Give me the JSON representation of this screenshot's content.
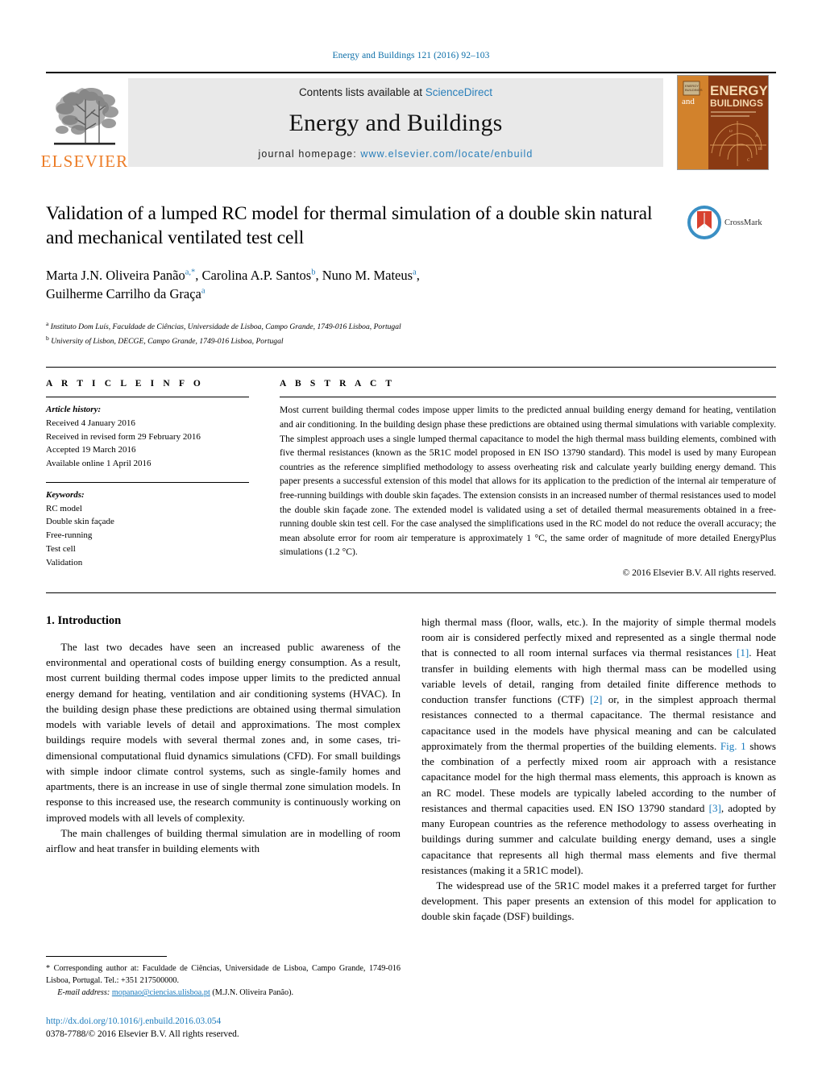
{
  "running_head": "Energy and Buildings 121 (2016) 92–103",
  "masthead": {
    "publisher_name": "ELSEVIER",
    "contents_prefix": "Contents lists available at ",
    "contents_link": "ScienceDirect",
    "journal_name": "Energy and Buildings",
    "homepage_prefix": "journal homepage: ",
    "homepage_url": "www.elsevier.com/locate/enbuild",
    "cover_title_line1": "ENERGY",
    "cover_title_line2": "and",
    "cover_title_line3": "BUILDINGS"
  },
  "article": {
    "title": "Validation of a lumped RC model for thermal simulation of a double skin natural and mechanical ventilated test cell",
    "crossmark_label": "CrossMark",
    "authors": [
      {
        "name": "Marta J.N. Oliveira Panão",
        "marks": "a,*"
      },
      {
        "name": "Carolina A.P. Santos",
        "marks": "b"
      },
      {
        "name": "Nuno M. Mateus",
        "marks": "a"
      },
      {
        "name": "Guilherme Carrilho da Graça",
        "marks": "a"
      }
    ],
    "affiliations": [
      {
        "mark": "a",
        "text": "Instituto Dom Luís, Faculdade de Ciências, Universidade de Lisboa, Campo Grande, 1749-016 Lisboa, Portugal"
      },
      {
        "mark": "b",
        "text": "University of Lisbon, DECGE, Campo Grande, 1749-016 Lisboa, Portugal"
      }
    ]
  },
  "article_info": {
    "heading": "A R T I C L E  I N F O",
    "history_label": "Article history:",
    "history": [
      "Received 4 January 2016",
      "Received in revised form 29 February 2016",
      "Accepted 19 March 2016",
      "Available online 1 April 2016"
    ],
    "keywords_label": "Keywords:",
    "keywords": [
      "RC model",
      "Double skin façade",
      "Free-running",
      "Test cell",
      "Validation"
    ]
  },
  "abstract": {
    "heading": "A B S T R A C T",
    "text": "Most current building thermal codes impose upper limits to the predicted annual building energy demand for heating, ventilation and air conditioning. In the building design phase these predictions are obtained using thermal simulations with variable complexity. The simplest approach uses a single lumped thermal capacitance to model the high thermal mass building elements, combined with five thermal resistances (known as the 5R1C model proposed in EN ISO 13790 standard). This model is used by many European countries as the reference simplified methodology to assess overheating risk and calculate yearly building energy demand. This paper presents a successful extension of this model that allows for its application to the prediction of the internal air temperature of free-running buildings with double skin façades. The extension consists in an increased number of thermal resistances used to model the double skin façade zone. The extended model is validated using a set of detailed thermal measurements obtained in a free-running double skin test cell. For the case analysed the simplifications used in the RC model do not reduce the overall accuracy; the mean absolute error for room air temperature is approximately 1 °C, the same order of magnitude of more detailed EnergyPlus simulations (1.2 °C).",
    "copyright": "© 2016 Elsevier B.V. All rights reserved."
  },
  "introduction": {
    "heading": "1.  Introduction",
    "left_paragraphs": [
      "The last two decades have seen an increased public awareness of the environmental and operational costs of building energy consumption. As a result, most current building thermal codes impose upper limits to the predicted annual energy demand for heating, ventilation and air conditioning systems (HVAC). In the building design phase these predictions are obtained using thermal simulation models with variable levels of detail and approximations. The most complex buildings require models with several thermal zones and, in some cases, tri-dimensional computational fluid dynamics simulations (CFD). For small buildings with simple indoor climate control systems, such as single-family homes and apartments, there is an increase in use of single thermal zone simulation models. In response to this increased use, the research community is continuously working on improved models with all levels of complexity.",
      "The main challenges of building thermal simulation are in modelling of room airflow and heat transfer in building elements with"
    ],
    "right_paragraph_1_part1": "high thermal mass (floor, walls, etc.). In the majority of simple thermal models room air is considered perfectly mixed and represented as a single thermal node that is connected to all room internal surfaces via thermal resistances ",
    "right_ref_1": "[1]",
    "right_paragraph_1_part2": ". Heat transfer in building elements with high thermal mass can be modelled using variable levels of detail, ranging from detailed finite difference methods to conduction transfer functions (CTF) ",
    "right_ref_2": "[2]",
    "right_paragraph_1_part3": " or, in the simplest approach thermal resistances connected to a thermal capacitance. The thermal resistance and capacitance used in the models have physical meaning and can be calculated approximately from the thermal properties of the building elements. ",
    "right_fig_ref": "Fig. 1",
    "right_paragraph_1_part4": " shows the combination of a perfectly mixed room air approach with a resistance capacitance model for the high thermal mass elements, this approach is known as an RC model. These models are typically labeled according to the number of resistances and thermal capacities used. EN ISO 13790 standard ",
    "right_ref_3": "[3]",
    "right_paragraph_1_part5": ", adopted by many European countries as the reference methodology to assess overheating in buildings during summer and calculate building energy demand, uses a single capacitance that represents all high thermal mass elements and five thermal resistances (making it a 5R1C model).",
    "right_paragraph_2": "The widespread use of the 5R1C model makes it a preferred target for further development. This paper presents an extension of this model for application to double skin façade (DSF) buildings."
  },
  "footnotes": {
    "corresponding": "* Corresponding author at: Faculdade de Ciências, Universidade de Lisboa, Campo Grande, 1749-016 Lisboa, Portugal. Tel.: +351 217500000.",
    "email_label": "E-mail address:",
    "email": "mopanao@ciencias.ulisboa.pt",
    "email_owner": "(M.J.N. Oliveira Panão)."
  },
  "footer": {
    "doi": "http://dx.doi.org/10.1016/j.enbuild.2016.03.054",
    "issn_line": "0378-7788/© 2016 Elsevier B.V. All rights reserved."
  },
  "colors": {
    "link_blue": "#1a7bbd",
    "running_head_blue": "#0b6ea8",
    "elsevier_orange": "#ec7c26",
    "band_gray": "#e9e9e9"
  }
}
